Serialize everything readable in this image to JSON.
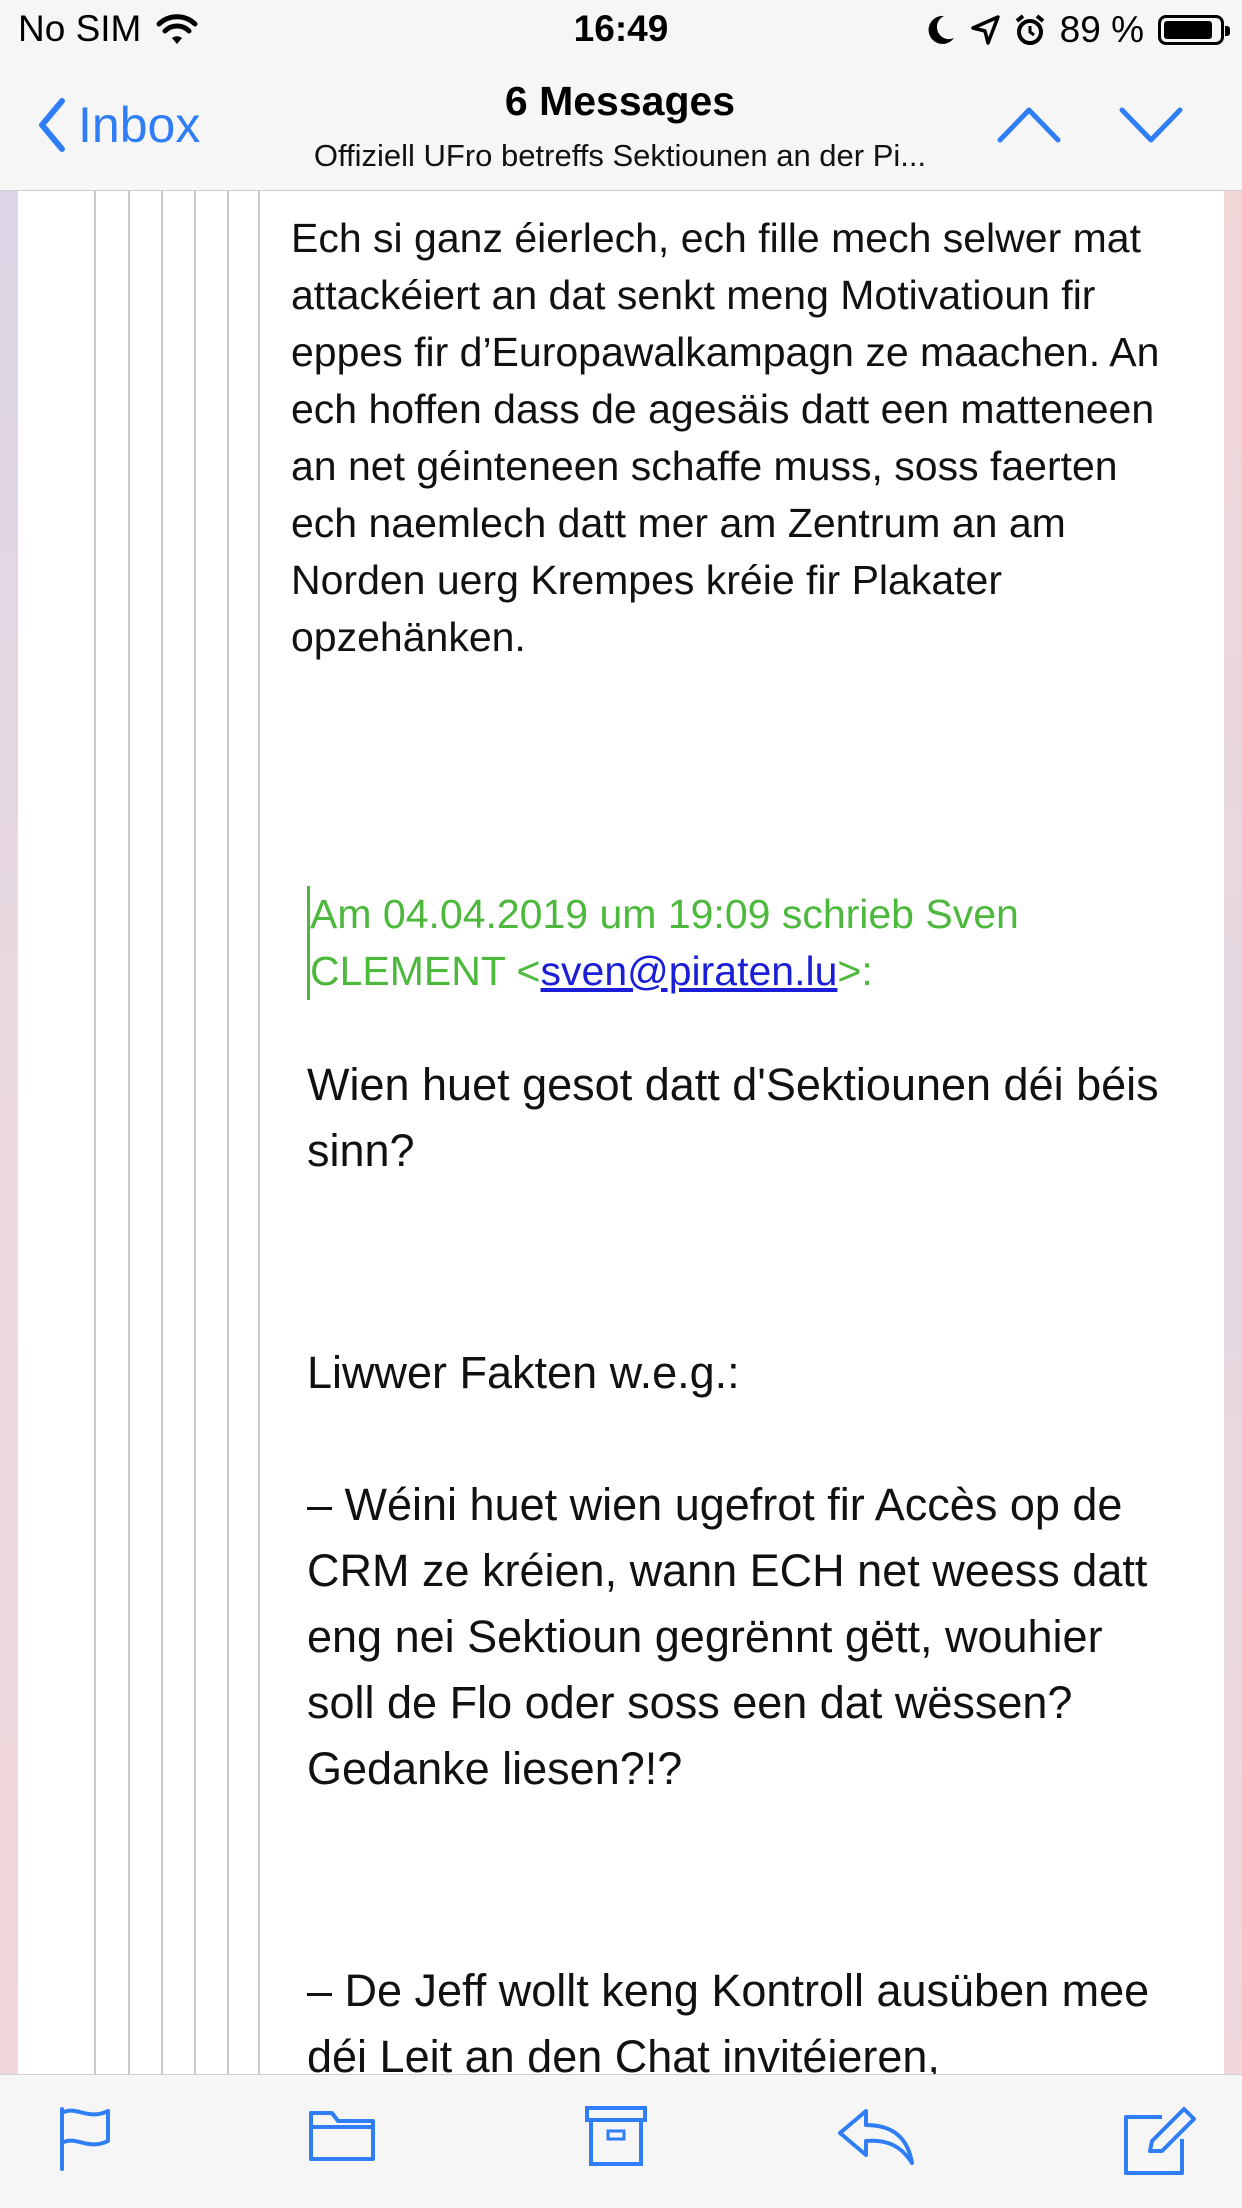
{
  "status": {
    "carrier": "No SIM",
    "time": "16:49",
    "battery_pct": "89 %",
    "battery_level": 0.89
  },
  "nav": {
    "back_label": "Inbox",
    "title": "6 Messages",
    "subtitle": "Offiziell UFro betreffs Sektiounen an der Pi..."
  },
  "message": {
    "paragraph": "Ech si ganz éierlech, ech fille mech selwer mat attackéiert an dat senkt meng Motivatioun fir eppes fir d’Europawalkampagn ze maachen. An ech hoffen dass de agesäis datt een matteneen an net géinteneen schaffe muss, soss faerten ech naemlech datt mer am Zentrum an am Norden uerg Krempes kréie fir Plakater opzehänken."
  },
  "quote": {
    "header_prefix": "Am 04.04.2019 um 19:09 schrieb Sven CLEMENT <",
    "email": "sven@piraten.lu",
    "header_suffix": ">:",
    "p1": "Wien huet gesot datt d'Sektiounen déi béis sinn?",
    "p2": "Liwwer Fakten w.e.g.:",
    "p3": "– Wéini huet wien ugefrot fir Accès op de CRM ze kréien, wann ECH net weess datt eng nei Sektioun gegrënnt gëtt, wouhier soll de Flo oder soss een dat wëssen? Gedanke liesen?!?",
    "p4": "– De Jeff wollt keng Kontroll ausüben mee déi Leit an den Chat invitéieren,"
  },
  "colors": {
    "accent": "#2f7ef6",
    "quote_green": "#4cb83c",
    "link": "#1a1ed6"
  },
  "toolbar": {
    "icons": [
      "flag-icon",
      "folder-icon",
      "archive-icon",
      "reply-icon",
      "compose-icon"
    ]
  }
}
